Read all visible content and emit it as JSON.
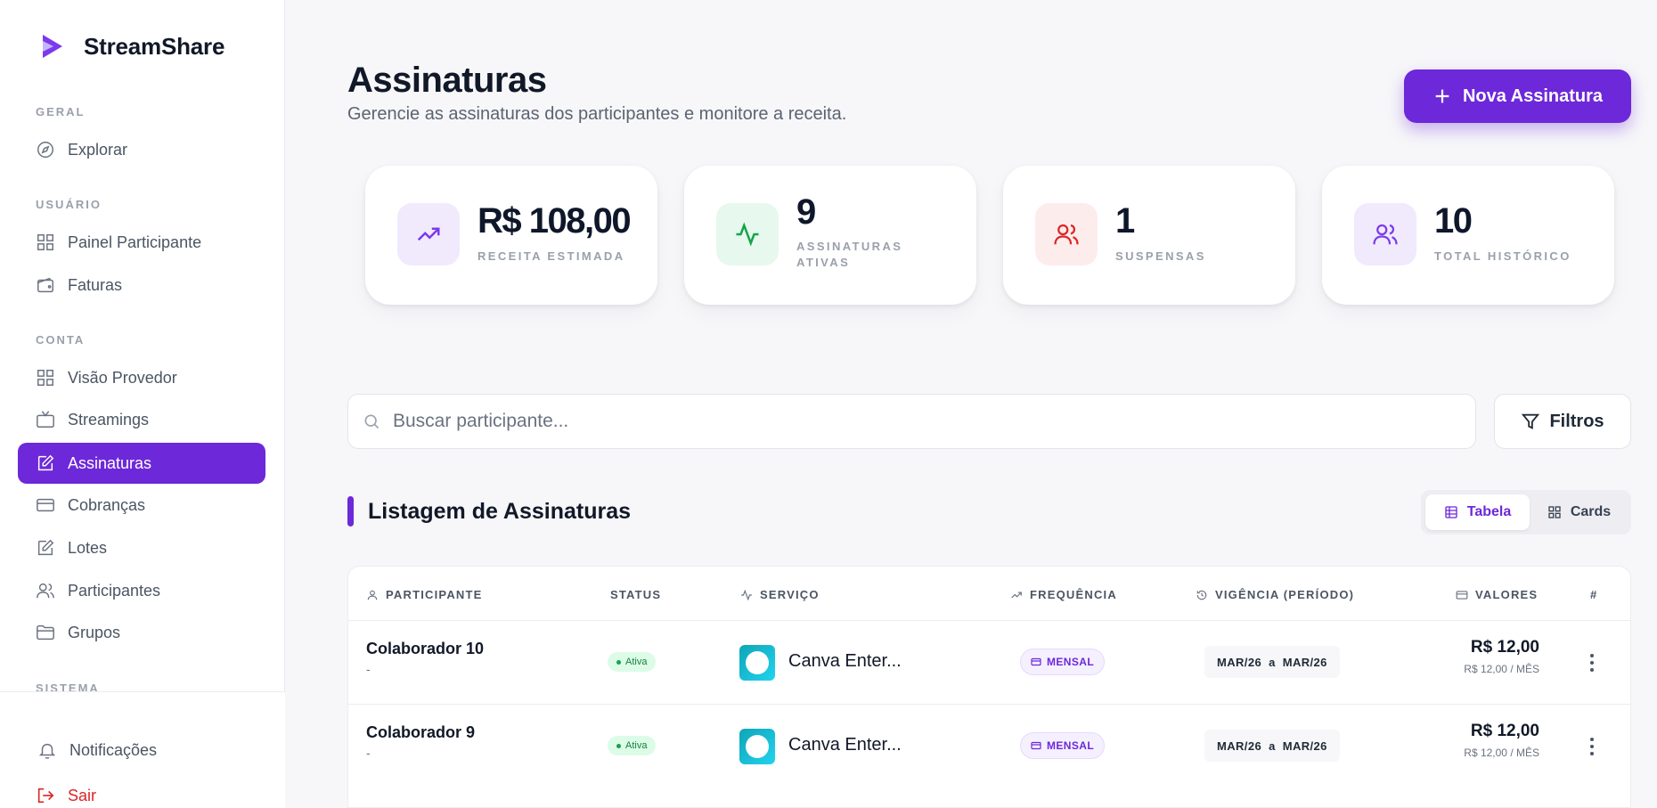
{
  "brand": {
    "name": "StreamShare"
  },
  "sidebar": {
    "sections": [
      {
        "label": "GERAL",
        "items": [
          {
            "label": "Explorar",
            "icon": "compass-icon"
          }
        ]
      },
      {
        "label": "USUÁRIO",
        "items": [
          {
            "label": "Painel Participante",
            "icon": "grid-icon"
          },
          {
            "label": "Faturas",
            "icon": "wallet-icon"
          }
        ]
      },
      {
        "label": "CONTA",
        "items": [
          {
            "label": "Visão Provedor",
            "icon": "grid-icon"
          },
          {
            "label": "Streamings",
            "icon": "tv-icon"
          },
          {
            "label": "Assinaturas",
            "icon": "edit-icon",
            "active": true
          },
          {
            "label": "Cobranças",
            "icon": "credit-card-icon"
          },
          {
            "label": "Lotes",
            "icon": "edit-icon"
          },
          {
            "label": "Participantes",
            "icon": "users-icon"
          },
          {
            "label": "Grupos",
            "icon": "folder-icon"
          }
        ]
      },
      {
        "label": "SISTEMA",
        "items": []
      }
    ],
    "bottom": {
      "notifications": "Notificações",
      "logout": "Sair"
    }
  },
  "header": {
    "title": "Assinaturas",
    "subtitle": "Gerencie as assinaturas dos participantes e monitore a receita.",
    "new_button": "Nova Assinatura"
  },
  "stats": [
    {
      "value": "R$ 108,00",
      "label": "RECEITA ESTIMADA",
      "icon": "trending-up-icon",
      "color": "#7c3aed",
      "bg": "#f1eafd"
    },
    {
      "value": "9",
      "label_line1": "ASSINATURAS",
      "label_line2": "ATIVAS",
      "icon": "activity-icon",
      "color": "#16a34a",
      "bg": "#e7f8ee"
    },
    {
      "value": "1",
      "label": "SUSPENSAS",
      "icon": "users-icon",
      "color": "#dc2626",
      "bg": "#fdecec"
    },
    {
      "value": "10",
      "label": "TOTAL HISTÓRICO",
      "icon": "users-icon",
      "color": "#7c3aed",
      "bg": "#f1eafd"
    }
  ],
  "search": {
    "placeholder": "Buscar participante..."
  },
  "filters_label": "Filtros",
  "list": {
    "title": "Listagem de Assinaturas",
    "view_table": "Tabela",
    "view_cards": "Cards"
  },
  "table": {
    "headers": {
      "participant": "PARTICIPANTE",
      "status": "STATUS",
      "service": "SERVIÇO",
      "frequency": "FREQUÊNCIA",
      "period": "VIGÊNCIA (PERÍODO)",
      "values": "VALORES",
      "actions": "#"
    },
    "rows": [
      {
        "name": "Colaborador 10",
        "sub": "-",
        "status": "Ativa",
        "service": "Canva Enter...",
        "frequency": "MENSAL",
        "period_start": "MAR/26",
        "period_sep": "a",
        "period_end": "MAR/26",
        "amount": "R$ 12,00",
        "amount_sub": "R$ 12,00 / MÊS"
      },
      {
        "name": "Colaborador 9",
        "sub": "-",
        "status": "Ativa",
        "service": "Canva Enter...",
        "frequency": "MENSAL",
        "period_start": "MAR/26",
        "period_sep": "a",
        "period_end": "MAR/26",
        "amount": "R$ 12,00",
        "amount_sub": "R$ 12,00 / MÊS"
      }
    ]
  },
  "colors": {
    "accent": "#6d28d9",
    "danger": "#dc2626",
    "success": "#16a34a"
  }
}
